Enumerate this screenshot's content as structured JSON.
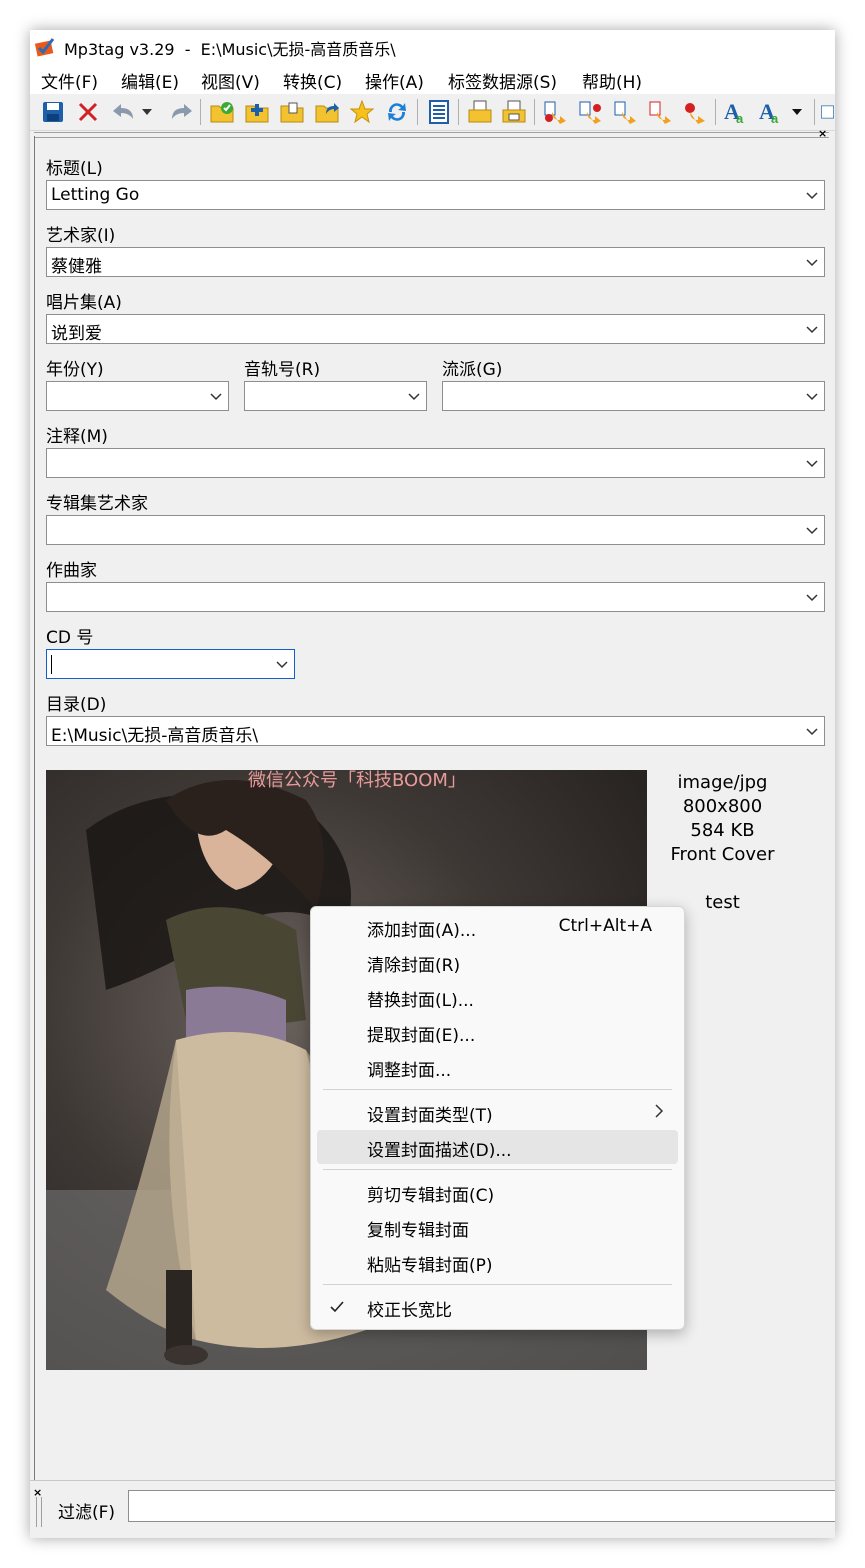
{
  "window": {
    "title": "Mp3tag v3.29  -  E:\\Music\\无损-高音质音乐\\"
  },
  "menubar": {
    "items": [
      "文件(F)",
      "编辑(E)",
      "视图(V)",
      "转换(C)",
      "操作(A)",
      "标签数据源(S)",
      "帮助(H)"
    ]
  },
  "toolbar": {
    "buttons": [
      "save-icon",
      "remove-tag-icon",
      "undo-icon",
      "undo-dropdown-icon",
      "redo-icon",
      "change-directory-icon",
      "add-directory-icon",
      "folder-export-icon",
      "open-folder-icon",
      "favorites-star-icon",
      "refresh-icon",
      "playlist-icon",
      "print-icon",
      "print-preview-icon",
      "tag-to-filename-icon",
      "filename-to-tag-icon",
      "tag-to-tag-icon",
      "text-file-to-tag-icon",
      "case-conversion-icon",
      "actions-quick-icon",
      "actions-icon",
      "actions-dropdown-icon"
    ]
  },
  "fields": {
    "title": {
      "label": "标题(L)",
      "value": "Letting Go"
    },
    "artist": {
      "label": "艺术家(I)",
      "value": "蔡健雅"
    },
    "album": {
      "label": "唱片集(A)",
      "value": "说到爱"
    },
    "year": {
      "label": "年份(Y)",
      "value": ""
    },
    "track": {
      "label": "音轨号(R)",
      "value": ""
    },
    "genre": {
      "label": "流派(G)",
      "value": ""
    },
    "comment": {
      "label": "注释(M)",
      "value": ""
    },
    "album_artist": {
      "label": "专辑集艺术家",
      "value": ""
    },
    "composer": {
      "label": "作曲家",
      "value": ""
    },
    "discnumber": {
      "label": "CD 号",
      "value": ""
    },
    "directory": {
      "label": "目录(D)",
      "value": "E:\\Music\\无损-高音质音乐\\"
    }
  },
  "cover": {
    "watermark": "微信公众号「科技BOOM」",
    "mime": "image/jpg",
    "dimensions": "800x800",
    "size": "584 KB",
    "type": "Front Cover",
    "description": "test"
  },
  "context_menu": {
    "add_cover": {
      "label": "添加封面(A)...",
      "shortcut": "Ctrl+Alt+A"
    },
    "remove_cover": {
      "label": "清除封面(R)"
    },
    "replace_cover": {
      "label": "替换封面(L)..."
    },
    "extract_cover": {
      "label": "提取封面(E)..."
    },
    "adjust_cover": {
      "label": "调整封面..."
    },
    "set_cover_type": {
      "label": "设置封面类型(T)"
    },
    "set_cover_description": {
      "label": "设置封面描述(D)..."
    },
    "cut_cover": {
      "label": "剪切专辑封面(C)"
    },
    "copy_cover": {
      "label": "复制专辑封面"
    },
    "paste_cover": {
      "label": "粘贴专辑封面(P)"
    },
    "aspect_ratio": {
      "label": "校正长宽比",
      "checked": true
    }
  },
  "statusbar": {
    "filter_label": "过滤(F)",
    "filter_value": ""
  },
  "colors": {
    "focus_border": "#0a64c8",
    "menu_hover": "#e5e5e5",
    "watermark": "#e89a9a"
  }
}
